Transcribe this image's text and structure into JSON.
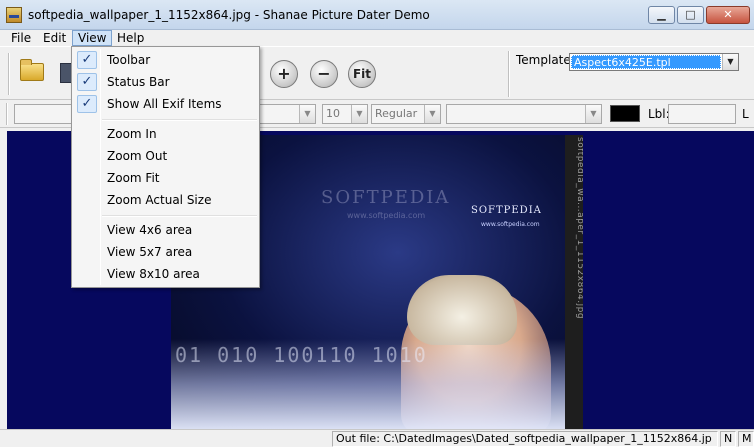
{
  "window": {
    "title": "softpedia_wallpaper_1_1152x864.jpg - Shanae Picture Dater Demo",
    "icon": "app-icon",
    "controls": {
      "minimize": "▁",
      "maximize": "□",
      "close": "✕"
    }
  },
  "menubar": {
    "items": [
      "File",
      "Edit",
      "View",
      "Help"
    ],
    "active": "View"
  },
  "toolbar": {
    "icons": [
      "open-folder-icon",
      "save-icon",
      "zoom-in-icon",
      "zoom-out-icon",
      "zoom-fit-icon"
    ],
    "zoom_in_label": "+",
    "zoom_out_label": "−",
    "fit_label": "Fit",
    "template_label": "Template:",
    "template_value": "Aspect6x425E.tpl"
  },
  "fontbar": {
    "size_value": "10",
    "style_value": "Regular",
    "lbl_label": "Lbl:",
    "cut_letter": "L",
    "color_swatch": "#000000"
  },
  "view_menu": {
    "items": [
      {
        "label": "Toolbar",
        "checked": true
      },
      {
        "label": "Status Bar",
        "checked": true
      },
      {
        "label": "Show All Exif Items",
        "checked": true
      },
      {
        "label": "Zoom In",
        "checked": false
      },
      {
        "label": "Zoom Out",
        "checked": false
      },
      {
        "label": "Zoom Fit",
        "checked": false
      },
      {
        "label": "Zoom Actual Size",
        "checked": false
      },
      {
        "label": "View 4x6 area",
        "checked": false
      },
      {
        "label": "View 5x7 area",
        "checked": false
      },
      {
        "label": "View 8x10 area",
        "checked": false
      }
    ],
    "check_glyph": "✓"
  },
  "image": {
    "side_text": "softpedia_wa...aper_1_1152x864.jpg",
    "brand": "SOFTPEDIA",
    "brand_sub": "www.softpedia.com",
    "watermark": "SOFTPEDIA",
    "watermark_sub": "www.softpedia.com",
    "digits": "01  010  100110  1010"
  },
  "statusbar": {
    "out_file": "Out file: C:\\DatedImages\\Dated_softpedia_wallpaper_1_1152x864.jp",
    "cell2": "N",
    "cell3": "M"
  }
}
